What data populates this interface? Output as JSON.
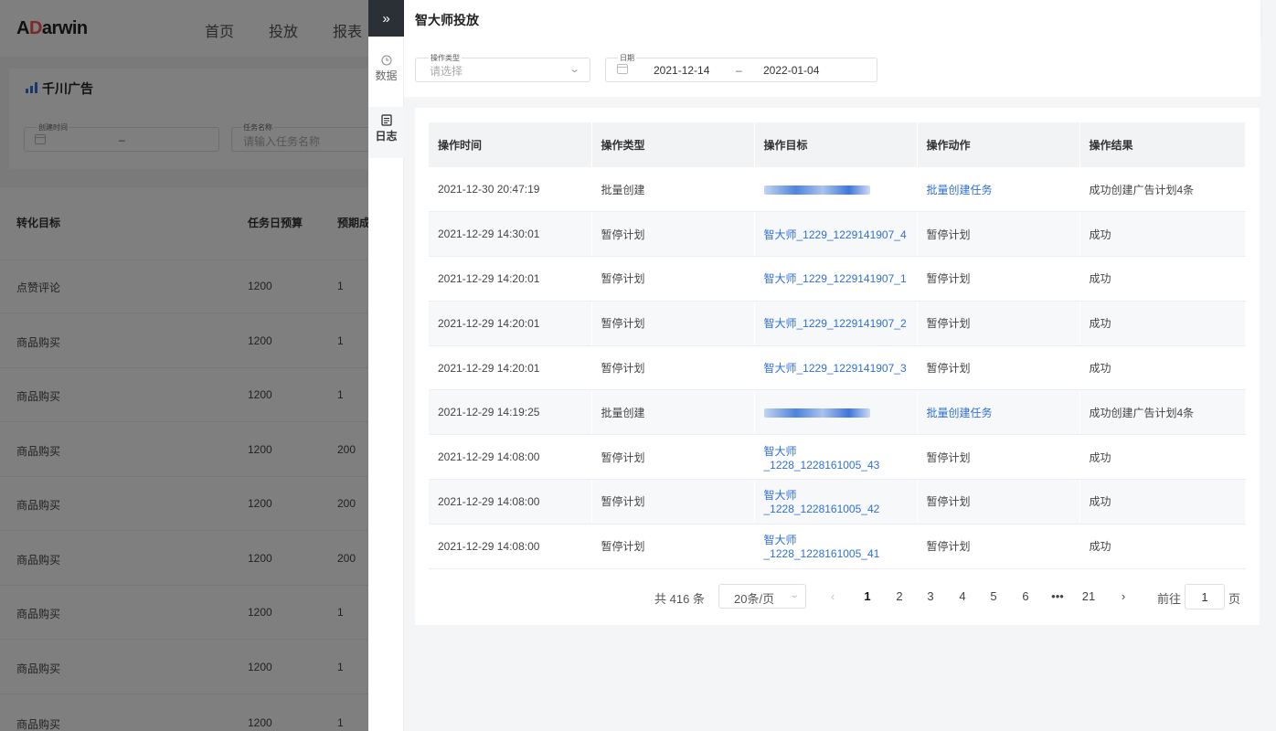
{
  "background": {
    "logo_prefix": "A",
    "logo_accent": "D",
    "logo_suffix": "arwin",
    "nav": [
      "首页",
      "投放",
      "报表"
    ],
    "tab_label": "千川广告",
    "filters": {
      "created_time_label": "创建时间",
      "range_sep": "–",
      "task_name_label": "任务名称",
      "task_name_placeholder": "请输入任务名称"
    },
    "columns": [
      "转化目标",
      "任务日预算",
      "预期成"
    ],
    "rows": [
      {
        "goal": "点赞评论",
        "budget": "1200",
        "expected": "1"
      },
      {
        "goal": "商品购买",
        "budget": "1200",
        "expected": "1"
      },
      {
        "goal": "商品购买",
        "budget": "1200",
        "expected": "1"
      },
      {
        "goal": "商品购买",
        "budget": "1200",
        "expected": "200"
      },
      {
        "goal": "商品购买",
        "budget": "1200",
        "expected": "200"
      },
      {
        "goal": "商品购买",
        "budget": "1200",
        "expected": "200"
      },
      {
        "goal": "商品购买",
        "budget": "1200",
        "expected": "1"
      },
      {
        "goal": "商品购买",
        "budget": "1200",
        "expected": "1"
      },
      {
        "goal": "商品购买",
        "budget": "1200",
        "expected": "1"
      }
    ]
  },
  "side_nav": {
    "collapse_icon": "»",
    "items": [
      {
        "label": "数据",
        "icon": "data-icon"
      },
      {
        "label": "日志",
        "icon": "log-icon"
      }
    ]
  },
  "drawer": {
    "title": "智大师投放",
    "filters": {
      "op_type_label": "操作类型",
      "op_type_placeholder": "请选择",
      "date_label": "日期",
      "date_start": "2021-12-14",
      "date_sep": "–",
      "date_end": "2022-01-04"
    },
    "table": {
      "columns": [
        "操作时间",
        "操作类型",
        "操作目标",
        "操作动作",
        "操作结果"
      ],
      "rows": [
        {
          "time": "2021-12-30 20:47:19",
          "type": "批量创建",
          "target": "",
          "target_redacted": true,
          "action": "批量创建任务",
          "action_link": true,
          "result": "成功创建广告计划4条"
        },
        {
          "time": "2021-12-29 14:30:01",
          "type": "暂停计划",
          "target": "智大师_1229_1229141907_4",
          "target_redacted": false,
          "action": "暂停计划",
          "action_link": false,
          "result": "成功"
        },
        {
          "time": "2021-12-29 14:20:01",
          "type": "暂停计划",
          "target": "智大师_1229_1229141907_1",
          "target_redacted": false,
          "action": "暂停计划",
          "action_link": false,
          "result": "成功"
        },
        {
          "time": "2021-12-29 14:20:01",
          "type": "暂停计划",
          "target": "智大师_1229_1229141907_2",
          "target_redacted": false,
          "action": "暂停计划",
          "action_link": false,
          "result": "成功"
        },
        {
          "time": "2021-12-29 14:20:01",
          "type": "暂停计划",
          "target": "智大师_1229_1229141907_3",
          "target_redacted": false,
          "action": "暂停计划",
          "action_link": false,
          "result": "成功"
        },
        {
          "time": "2021-12-29 14:19:25",
          "type": "批量创建",
          "target": "",
          "target_redacted": true,
          "action": "批量创建任务",
          "action_link": true,
          "result": "成功创建广告计划4条"
        },
        {
          "time": "2021-12-29 14:08:00",
          "type": "暂停计划",
          "target": "智大师_1228_1228161005_43",
          "target_redacted": false,
          "action": "暂停计划",
          "action_link": false,
          "result": "成功"
        },
        {
          "time": "2021-12-29 14:08:00",
          "type": "暂停计划",
          "target": "智大师_1228_1228161005_42",
          "target_redacted": false,
          "action": "暂停计划",
          "action_link": false,
          "result": "成功"
        },
        {
          "time": "2021-12-29 14:08:00",
          "type": "暂停计划",
          "target": "智大师_1228_1228161005_41",
          "target_redacted": false,
          "action": "暂停计划",
          "action_link": false,
          "result": "成功"
        }
      ]
    },
    "pagination": {
      "total_text": "共 416 条",
      "page_size": "20条/页",
      "prev_icon": "‹",
      "next_icon": "›",
      "pages": [
        "1",
        "2",
        "3",
        "4",
        "5",
        "6",
        "•••",
        "21"
      ],
      "current_page": "1",
      "goto_label": "前往",
      "goto_value": "1",
      "goto_unit": "页"
    }
  },
  "colors": {
    "link": "#2f6fd6",
    "dark_button": "#2b2f36",
    "accent": "#ff4d4f"
  }
}
